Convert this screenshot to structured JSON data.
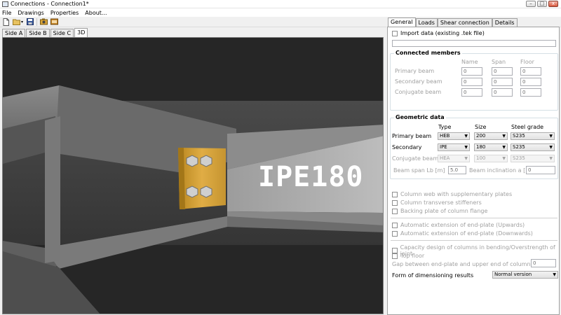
{
  "window": {
    "title": "Connections - Connection1*",
    "minimize": "–",
    "maximize": "□",
    "close": "x"
  },
  "menu": [
    "File",
    "Drawings",
    "Properties",
    "About..."
  ],
  "toolbar": {
    "icons": [
      "new-file-icon",
      "open-folder-icon",
      "save-icon",
      "camera-icon",
      "export-icon"
    ],
    "dropdown_glyph": "▾"
  },
  "view_tabs": [
    {
      "label": "Side A"
    },
    {
      "label": "Side B"
    },
    {
      "label": "Side C"
    },
    {
      "label": "3D",
      "active": true
    }
  ],
  "viewport": {
    "beam_label": "IPE180"
  },
  "panel": {
    "tabs": [
      {
        "label": "General",
        "active": true
      },
      {
        "label": "Loads"
      },
      {
        "label": "Shear connection"
      },
      {
        "label": "Details"
      }
    ],
    "import": {
      "label": "Import data (existing .tek file)",
      "checked": false,
      "value": ""
    },
    "connected": {
      "title": "Connected members",
      "headers": [
        "Name",
        "Span",
        "Floor"
      ],
      "rows": [
        {
          "label": "Primary beam",
          "values": [
            "0",
            "0",
            "0"
          ]
        },
        {
          "label": "Secondary beam",
          "values": [
            "0",
            "0",
            "0"
          ]
        },
        {
          "label": "Conjugate beam",
          "values": [
            "0",
            "0",
            "0"
          ]
        }
      ]
    },
    "geometric": {
      "title": "Geometric data",
      "headers": [
        "Type",
        "Size",
        "Steel grade"
      ],
      "rows": [
        {
          "label": "Primary beam",
          "type": "HEB",
          "size": "200",
          "grade": "S235",
          "enabled": true
        },
        {
          "label": "Secondary",
          "type": "IPE",
          "size": "180",
          "grade": "S235",
          "enabled": true
        },
        {
          "label": "Conjugate beam",
          "type": "HEA",
          "size": "100",
          "grade": "S235",
          "enabled": false
        }
      ],
      "span_label": "Beam span Lb [m]",
      "span_value": "5.0",
      "incl_label": "Beam inclination a [°]",
      "incl_value": "0"
    },
    "options_a": [
      "Column web with supplementary plates",
      "Column transverse stiffeners",
      "Backing plate of column flange"
    ],
    "options_b": [
      "Automatic extension of end-plate (Upwards)",
      "Automatic extension of end-plate (Downwards)"
    ],
    "options_c": [
      "Capacity design of columns in bending/Overstrength of joint",
      "Top floor"
    ],
    "gap": {
      "label": "Gap between end-plate and upper end of column [mm]",
      "value": "0"
    },
    "form": {
      "label": "Form of dimensioning results",
      "value": "Normal version"
    }
  },
  "colors": {
    "viewport_bg": "#262626",
    "plate": "#d9a437",
    "steel": "#6e6e6e"
  }
}
